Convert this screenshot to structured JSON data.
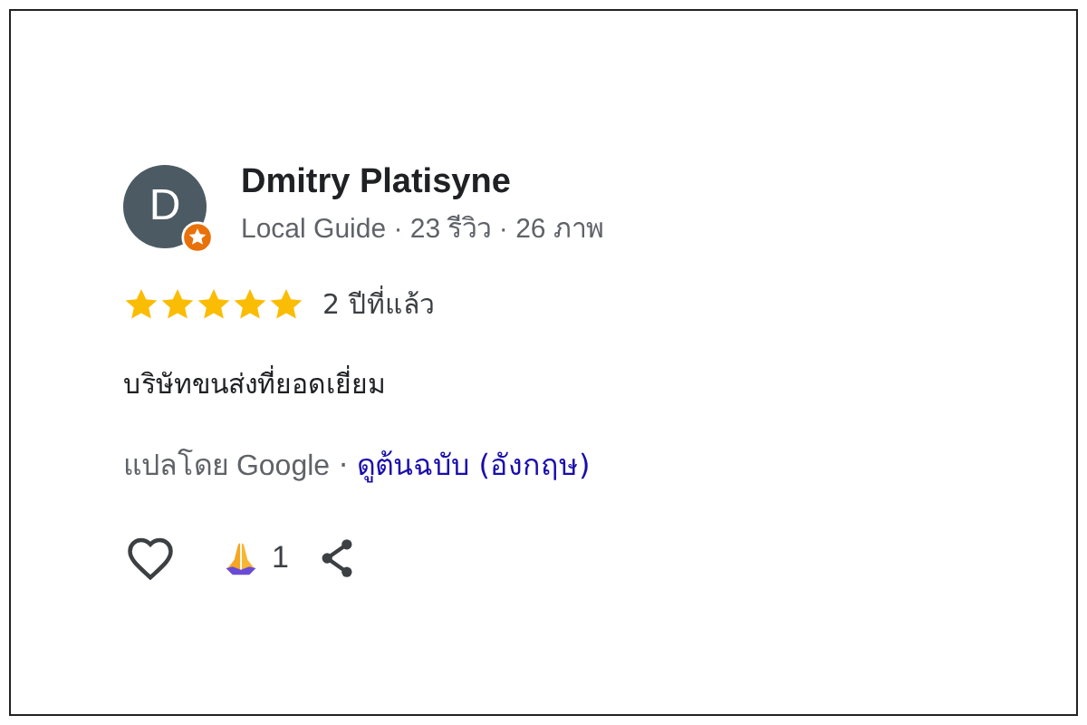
{
  "review": {
    "author": {
      "initial": "D",
      "name": "Dmitry Platisyne",
      "meta": "Local Guide · 23 รีวิว · 26 ภาพ"
    },
    "stars": 5,
    "time": "2 ปีที่แล้ว",
    "text": "บริษัทขนส่งที่ยอดเยี่ยม",
    "translation": {
      "label": "แปลโดย Google",
      "separator": "·",
      "link": "ดูต้นฉบับ (อังกฤษ)"
    },
    "reactions": {
      "count": "1"
    }
  }
}
